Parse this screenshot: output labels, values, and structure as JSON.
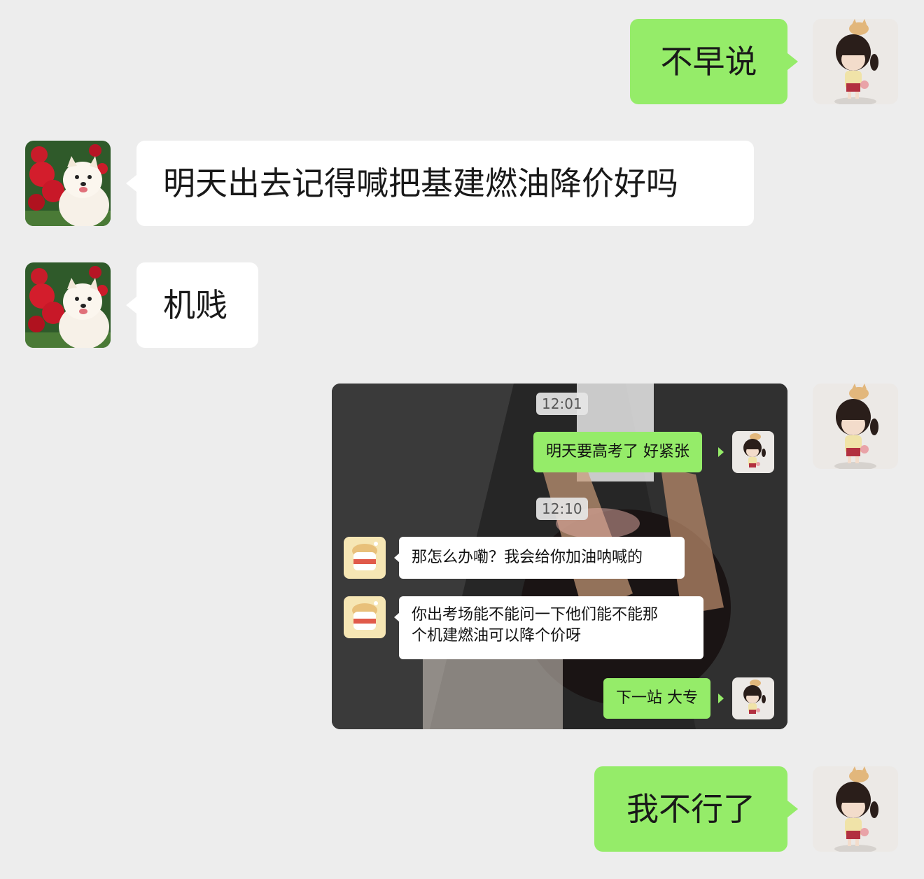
{
  "messages": [
    {
      "side": "me",
      "text": "不早说"
    },
    {
      "side": "other",
      "text": "明天出去记得喊把基建燃油降价好吗"
    },
    {
      "side": "other",
      "text": "机贱"
    },
    {
      "side": "me",
      "type": "image"
    },
    {
      "side": "me",
      "text": "我不行了"
    }
  ],
  "embedded_screenshot": {
    "time1": "12:01",
    "msg1": "明天要高考了 好紧张",
    "time2": "12:10",
    "msg2": "那怎么办嘞？我会给你加油呐喊的",
    "msg3_line1": "你出考场能不能问一下他们能不能那",
    "msg3_line2": "个机建燃油可以降个价呀",
    "msg4": "下一站 大专"
  },
  "colors": {
    "background": "#ededed",
    "my_bubble": "#95ec69",
    "other_bubble": "#ffffff"
  },
  "icons": {
    "my_avatar": "girl-with-cat-avatar",
    "other_avatar": "pomeranian-roses-avatar",
    "cake_avatar": "pudding-cup-avatar"
  }
}
